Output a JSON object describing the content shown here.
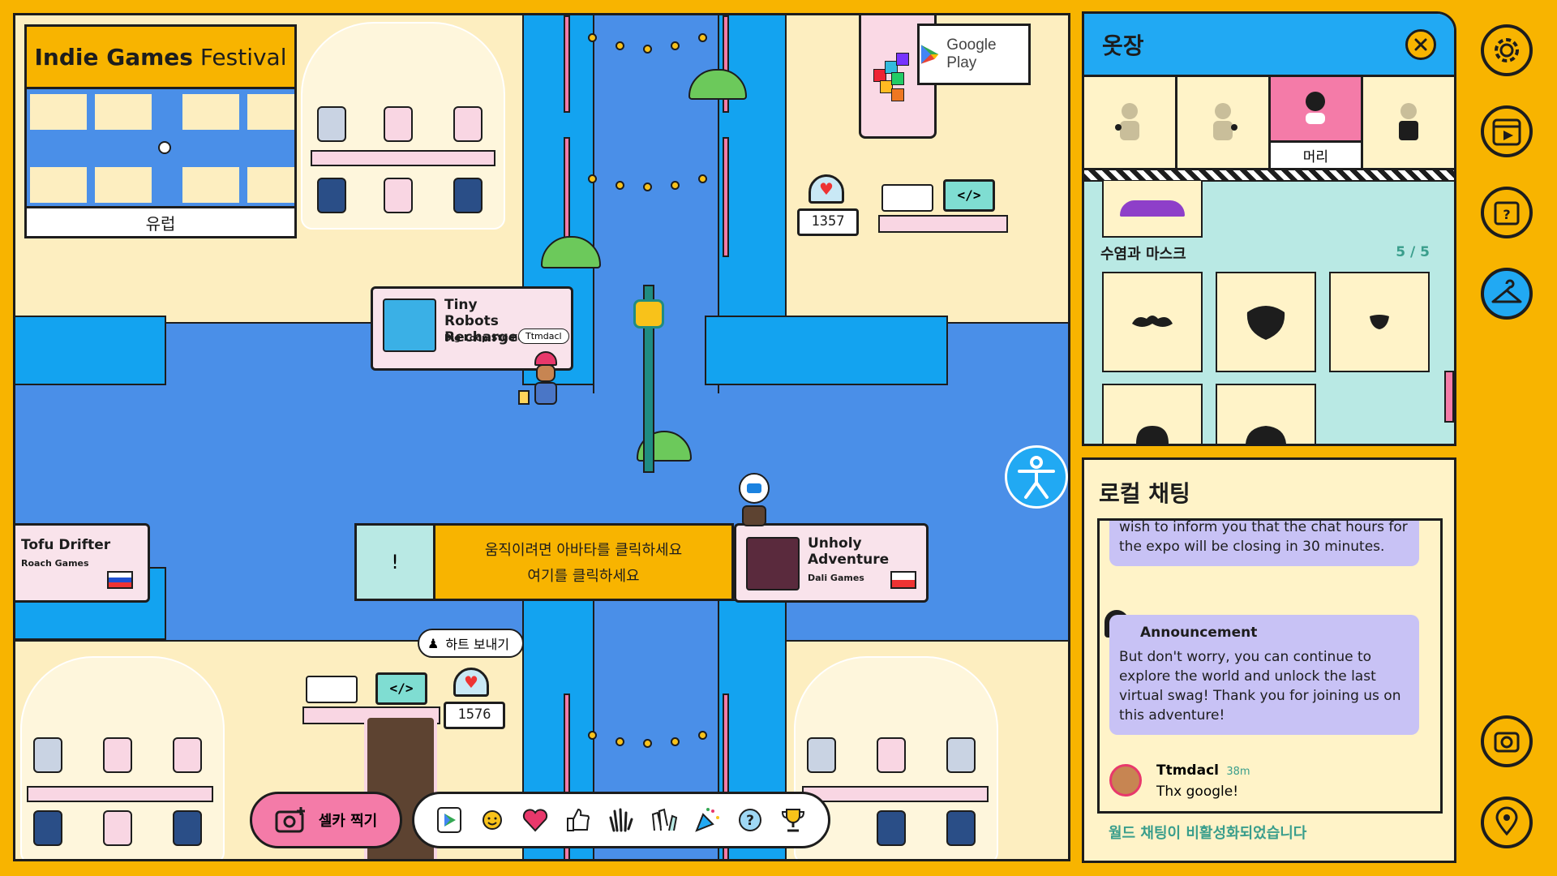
{
  "minimap": {
    "title_bold": "Indie Games",
    "title_rest": " Festival",
    "region": "유럽"
  },
  "google_play": {
    "label": "Google Play"
  },
  "booths": [
    {
      "title": "Tiny Robots Recharged",
      "studio": "Big Loop Studios"
    },
    {
      "title": "Tofu Drifter",
      "studio": "Roach Games"
    },
    {
      "title": "Unholy Adventure",
      "studio": "Dali Games"
    }
  ],
  "counters": {
    "top": "1357",
    "bottom": "1576"
  },
  "player": {
    "name": "Ttmdacl"
  },
  "hint": {
    "icon": "!",
    "line1": "움직이려면 아바타를 클릭하세요",
    "line2": "여기를 클릭하세요"
  },
  "heart_bubble": {
    "label": "하트 보내기"
  },
  "bottom_bar": {
    "selfie_label": "셀카 찍기",
    "emotes": [
      "play-store-emote",
      "sun-emote",
      "heart-emote",
      "thumbs-up-emote",
      "wave-emote",
      "clap-emote",
      "party-popper-emote",
      "question-emote",
      "trophy-emote"
    ]
  },
  "wardrobe": {
    "title": "옷장",
    "tabs": [
      {
        "label": ""
      },
      {
        "label": ""
      },
      {
        "label": "머리"
      },
      {
        "label": ""
      }
    ],
    "active_tab": 2,
    "section_title": "수염과 마스크",
    "section_count": "5 / 5"
  },
  "chat": {
    "title": "로컬 채팅",
    "msg1": "wish to inform you that the chat hours for the expo will be closing in 30 minutes.",
    "announcement_title": "Announcement",
    "msg2": "But don't worry, you can continue to explore the world and unlock the last virtual swag! Thank you for joining us on this adventure!",
    "user_name": "Ttmdacl",
    "user_time": "38m",
    "user_msg": "Thx google!",
    "footer": "월드 채팅이 비활성화되었습니다"
  },
  "colors": {
    "accent": "#F8B400",
    "water": "#4A8FE8",
    "panel_blue": "#21A9F3",
    "chat_bubble": "#C8C2F5",
    "wardrobe_bg": "#B9E9E4"
  }
}
